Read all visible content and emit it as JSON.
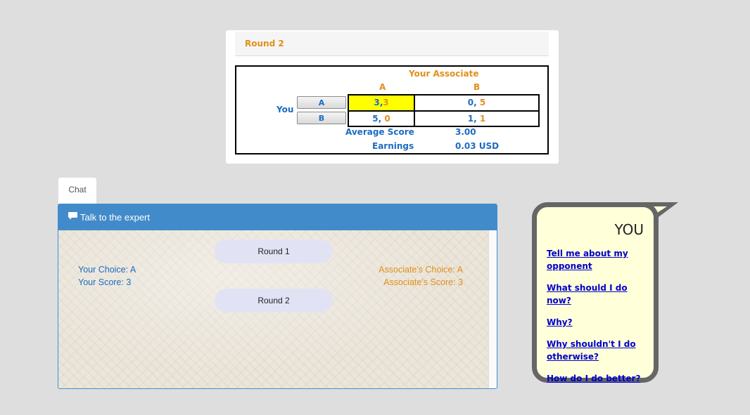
{
  "game": {
    "round_title": "Round 2",
    "associate_label": "Your Associate",
    "col_a": "A",
    "col_b": "B",
    "you_label": "You",
    "row_a": "A",
    "row_b": "B",
    "cells": {
      "aa_you": "3",
      "aa_assoc": "3",
      "ab_you": "0",
      "ab_assoc": "5",
      "ba_you": "5",
      "ba_assoc": "0",
      "bb_you": "1",
      "bb_assoc": "1"
    },
    "average_label": "Average Score",
    "average_value": "3.00",
    "earnings_label": "Earnings",
    "earnings_value": "0.03 USD",
    "highlight_color": "#ffff00"
  },
  "chat": {
    "tab_label": "Chat",
    "header_title": "Talk to the expert",
    "header_icon": "comment-icon",
    "rounds": [
      {
        "label": "Round 1"
      },
      {
        "label": "Round 2"
      }
    ],
    "your_choice": "Your Choice: A",
    "your_score": "Your Score: 3",
    "assoc_choice": "Associate's Choice: A",
    "assoc_score": "Associate's Score: 3"
  },
  "bubble": {
    "title": "YOU",
    "questions": [
      "Tell me about my opponent",
      "What should I do now?",
      "Why?",
      "Why shouldn't I do otherwise?",
      "How do I do better?"
    ]
  },
  "colors": {
    "accent_orange": "#e0901a",
    "accent_blue": "#1d6cc0",
    "header_blue": "#428bca"
  }
}
